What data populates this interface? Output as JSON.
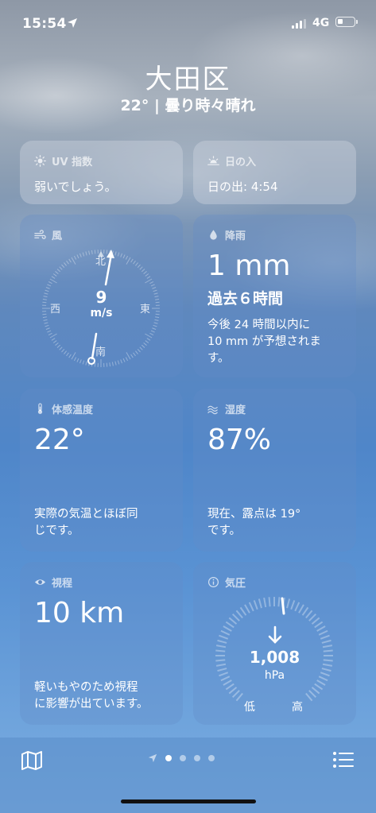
{
  "status": {
    "time": "15:54",
    "network": "4G"
  },
  "header": {
    "city": "大田区",
    "summary": "22° | 曇り時々晴れ"
  },
  "uv": {
    "title": "UV 指数",
    "text": "弱いでしょう。"
  },
  "sunset": {
    "title": "日の入",
    "text": "日の出: 4:54"
  },
  "wind": {
    "title": "風",
    "speed": "9",
    "unit": "m/s",
    "dir_n": "北",
    "dir_e": "東",
    "dir_s": "南",
    "dir_w": "西"
  },
  "rain": {
    "title": "降雨",
    "value": "1 mm",
    "period": "過去６時間",
    "desc1": "今後 24 時間以内に",
    "desc2": "10 mm が予想されま",
    "desc3": "す。"
  },
  "feels": {
    "title": "体感温度",
    "value": "22°",
    "desc1": "実際の気温とほぼ同",
    "desc2": "じです。"
  },
  "humidity": {
    "title": "湿度",
    "value": "87%",
    "desc1": "現在、露点は 19°",
    "desc2": "です。"
  },
  "visibility": {
    "title": "視程",
    "value": "10 km",
    "desc1": "軽いもやのため視程",
    "desc2": "に影響が出ています。"
  },
  "pressure": {
    "title": "気圧",
    "value": "1,008",
    "unit": "hPa",
    "low": "低",
    "high": "高",
    "trend": "falling"
  },
  "icons": {
    "sun": "sun-icon",
    "sunset": "sunset-icon",
    "wind": "wind-icon",
    "rain": "raindrop-icon",
    "thermometer": "thermometer-icon",
    "humidity": "humidity-icon",
    "eye": "eye-icon",
    "gauge": "gauge-icon",
    "map": "map-icon",
    "list": "list-icon",
    "location": "location-arrow-icon"
  },
  "pager": {
    "pages": 4,
    "current": 1
  }
}
